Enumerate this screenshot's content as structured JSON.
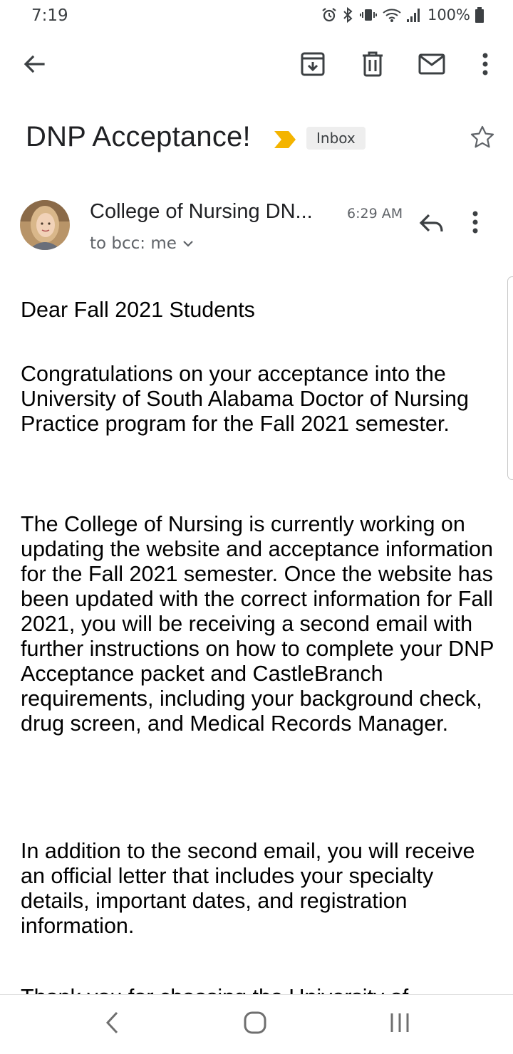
{
  "status_bar": {
    "time": "7:19",
    "battery": "100%"
  },
  "toolbar": {
    "back_icon": "arrow-back-icon",
    "archive_icon": "archive-icon",
    "delete_icon": "trash-icon",
    "mark_unread_icon": "mail-icon",
    "more_icon": "more-vert-icon"
  },
  "email": {
    "subject": "DNP Acceptance!",
    "label": "Inbox",
    "important_color": "#f4b400",
    "sender": "College of Nursing DN...",
    "time": "6:29 AM",
    "recipients": "to bcc: me",
    "body": [
      "Dear Fall 2021 Students",
      "Congratulations on your acceptance into the University of South Alabama Doctor of Nursing Practice program for the Fall 2021 semester.",
      "The College of Nursing is currently working on updating the website and acceptance information for the Fall 2021 semester. Once the website has been updated with the correct information for Fall 2021, you will be receiving a second email with further instructions on how to complete your DNP Acceptance packet and CastleBranch requirements, including your background check, drug screen, and Medical Records Manager.",
      "In addition to the second email, you will receive an official letter that includes your specialty details, important dates, and registration information.",
      "Thank you for choosing the University of"
    ]
  },
  "nav": {
    "back_icon": "nav-back-icon",
    "home_icon": "nav-home-icon",
    "recents_icon": "nav-recents-icon"
  }
}
